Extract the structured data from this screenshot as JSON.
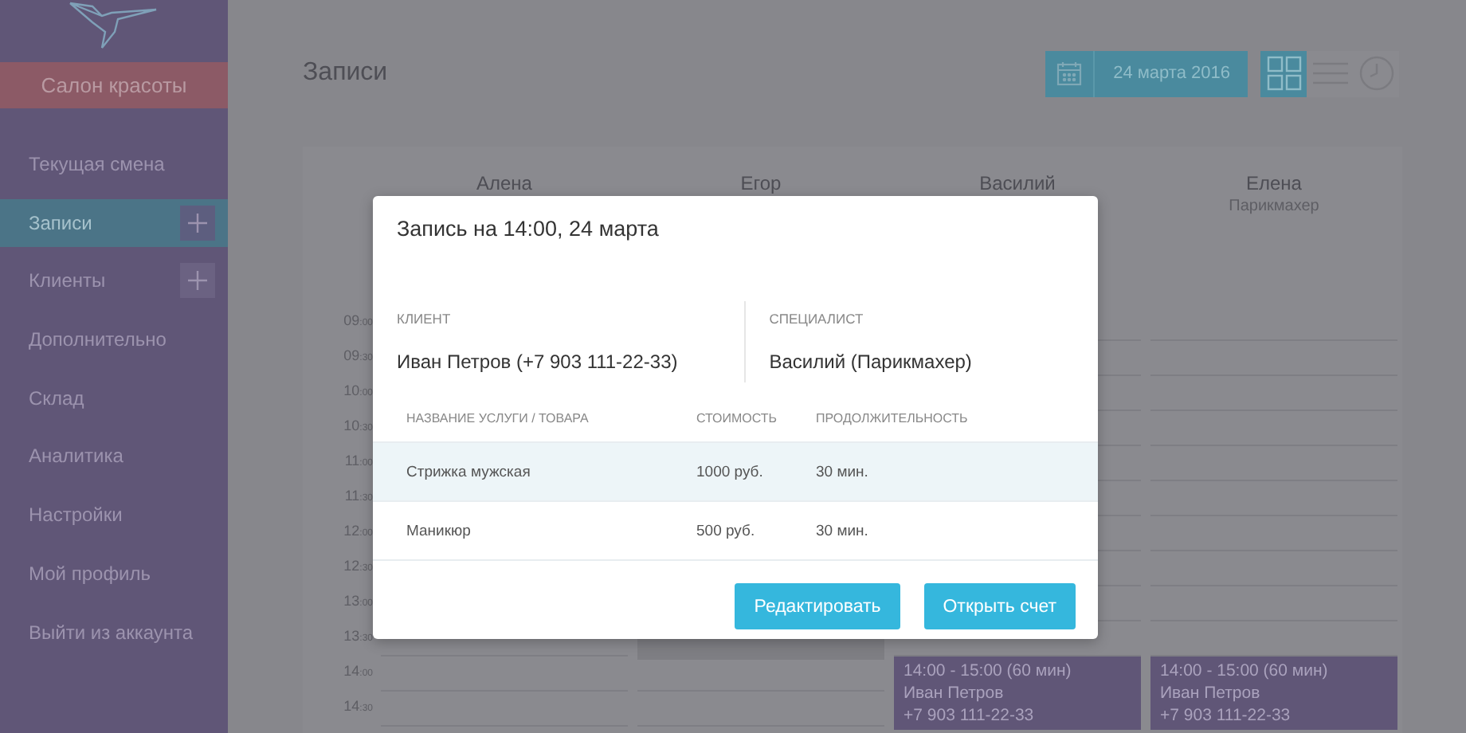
{
  "sidebar": {
    "brand": "Салон красоты",
    "items": [
      {
        "label": "Текущая смена",
        "selected": false,
        "has_add": false
      },
      {
        "label": "Записи",
        "selected": true,
        "has_add": true
      },
      {
        "label": "Клиенты",
        "selected": false,
        "has_add": true
      },
      {
        "label": "Дополнительно",
        "selected": false,
        "has_add": false
      },
      {
        "label": "Склад",
        "selected": false,
        "has_add": false
      },
      {
        "label": "Аналитика",
        "selected": false,
        "has_add": false
      },
      {
        "label": "Настройки",
        "selected": false,
        "has_add": false
      },
      {
        "label": "Мой профиль",
        "selected": false,
        "has_add": false
      },
      {
        "label": "Выйти из аккаунта",
        "selected": false,
        "has_add": false
      }
    ]
  },
  "header": {
    "title": "Записи",
    "date": "24 марта 2016",
    "views": [
      {
        "kind": "grid",
        "selected": true
      },
      {
        "kind": "list",
        "selected": false
      },
      {
        "kind": "clock",
        "selected": false
      }
    ]
  },
  "schedule": {
    "times": [
      {
        "hour": "09",
        "minute": ":00"
      },
      {
        "hour": "09",
        "minute": ":30"
      },
      {
        "hour": "10",
        "minute": ":00"
      },
      {
        "hour": "10",
        "minute": ":30"
      },
      {
        "hour": "11",
        "minute": ":00"
      },
      {
        "hour": "11",
        "minute": ":30"
      },
      {
        "hour": "12",
        "minute": ":00"
      },
      {
        "hour": "12",
        "minute": ":30"
      },
      {
        "hour": "13",
        "minute": ":00"
      },
      {
        "hour": "13",
        "minute": ":30"
      },
      {
        "hour": "14",
        "minute": ":00"
      },
      {
        "hour": "14",
        "minute": ":30"
      }
    ],
    "staff": [
      {
        "name": "Алена",
        "blocked": false
      },
      {
        "name": "Егор",
        "blocked": true
      },
      {
        "name": "Василий",
        "blocked": false,
        "appointments": [
          {
            "time": "14:00 - 15:00 (60 мин)",
            "client": "Иван Петров",
            "phone": "+7 903 111-22-33"
          }
        ]
      },
      {
        "name": "Елена",
        "role": "Парикмахер",
        "blocked": false,
        "appointments": [
          {
            "time": "14:00 - 15:00 (60 мин)",
            "client": "Иван Петров",
            "phone": "+7 903 111-22-33"
          }
        ]
      }
    ]
  },
  "modal": {
    "title": "Запись на 14:00, 24 марта",
    "client_label": "КЛИЕНТ",
    "client": "Иван Петров (+7 903 111-22-33)",
    "specialist_label": "СПЕЦИАЛИСТ",
    "specialist": "Василий (Парикмахер)",
    "columns": [
      "НАЗВАНИЕ УСЛУГИ / ТОВАРА",
      "СТОИМОСТЬ",
      "ПРОДОЛЖИТЕЛЬНОСТЬ"
    ],
    "rows": [
      {
        "name": "Стрижка мужская",
        "price": "1000 руб.",
        "duration": "30 мин.",
        "highlighted": true
      },
      {
        "name": "Маникюр",
        "price": "500 руб.",
        "duration": "30 мин.",
        "highlighted": false
      }
    ],
    "buttons": [
      "Редактировать",
      "Открыть счет"
    ]
  }
}
